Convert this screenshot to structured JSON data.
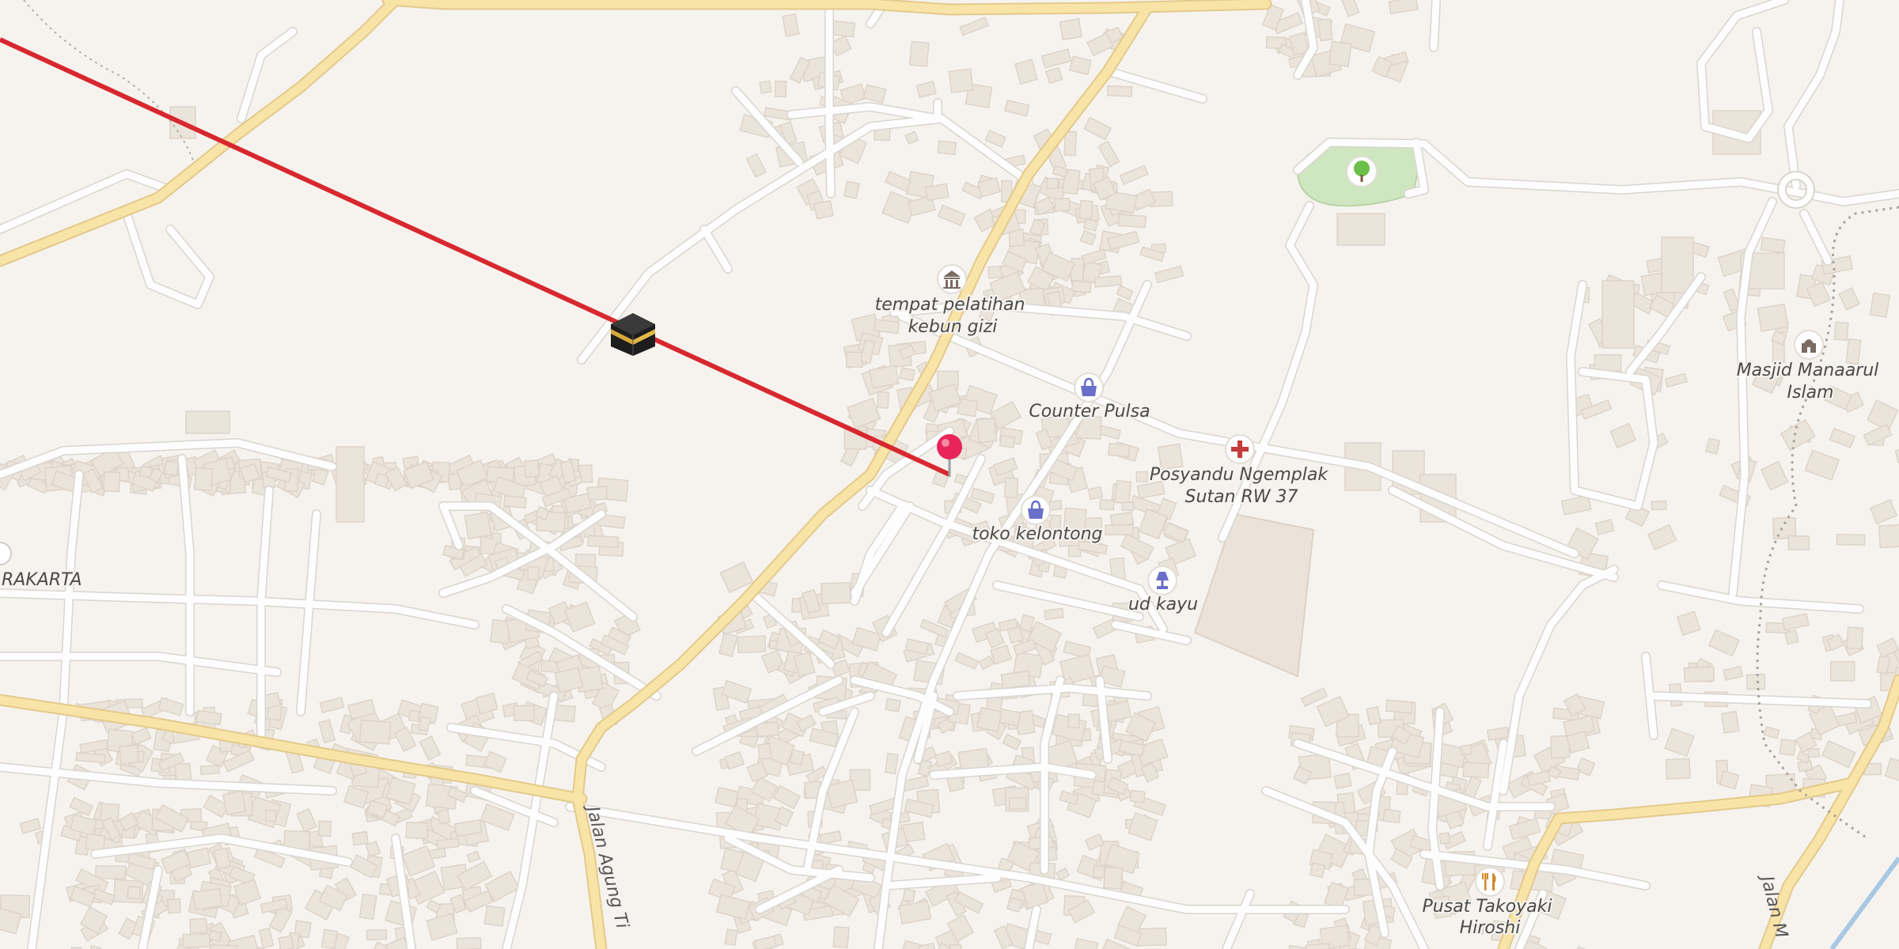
{
  "map": {
    "places": [
      {
        "id": "tempat",
        "lines": [
          "tempat pelatihan",
          "kebun gizi"
        ],
        "icon": "museum-icon"
      },
      {
        "id": "counter",
        "lines": [
          "Counter Pulsa"
        ],
        "icon": "shop-bag-icon"
      },
      {
        "id": "posyandu",
        "lines": [
          "Posyandu Ngemplak",
          "Sutan RW 37"
        ],
        "icon": "medical-cross-icon"
      },
      {
        "id": "toko",
        "lines": [
          "toko kelontong"
        ],
        "icon": "shop-bag-icon"
      },
      {
        "id": "udkayu",
        "lines": [
          "ud kayu"
        ],
        "icon": "lamp-shop-icon"
      },
      {
        "id": "masjid",
        "lines": [
          "Masjid Manaarul",
          "Islam"
        ],
        "icon": "mosque-icon"
      },
      {
        "id": "takoyaki",
        "lines": [
          "Pusat Takoyaki",
          "Hiroshi"
        ],
        "icon": "restaurant-icon"
      },
      {
        "id": "rakarta",
        "lines": [
          "RAKARTA"
        ],
        "icon": ""
      },
      {
        "id": "park",
        "lines": [],
        "icon": "tree-icon"
      }
    ],
    "road_labels": {
      "agung": "Jalan Agung Ti",
      "jalan_m": "Jalan M"
    },
    "markers": {
      "kaaba": "kaaba-icon",
      "pin": "location-pin-icon"
    },
    "colors": {
      "qibla_line": "#d7282f",
      "pin": "#e8245a",
      "poi_blue": "#6a6fc9",
      "poi_red": "#c43c3c",
      "poi_park": "#6cbf4a",
      "poi_gray": "#7a6b63",
      "major_road": "#f9e4a8"
    }
  }
}
